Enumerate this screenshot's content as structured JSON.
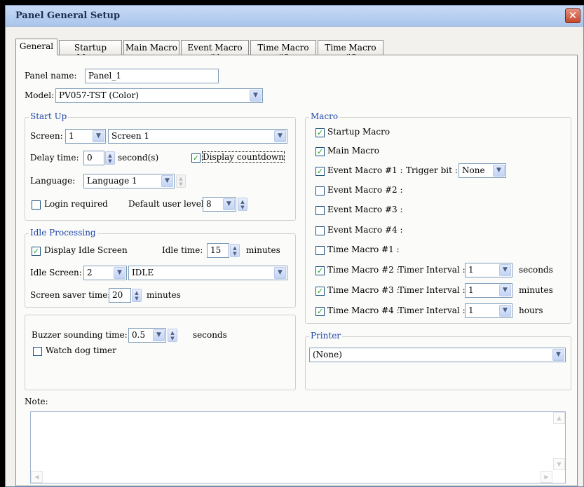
{
  "window": {
    "title": "Panel General Setup",
    "close_glyph": "✕"
  },
  "tabs": [
    {
      "label": "General"
    },
    {
      "label": "Startup Macro"
    },
    {
      "label": "Main Macro"
    },
    {
      "label": "Event Macro #1"
    },
    {
      "label": "Time Macro #2"
    },
    {
      "label": "Time Macro #3"
    }
  ],
  "general": {
    "panel_name_label": "Panel name:",
    "panel_name_value": "Panel_1",
    "model_label": "Model:",
    "model_value": "PV057-TST (Color)"
  },
  "startup": {
    "group_label": "Start Up",
    "screen_label": "Screen:",
    "screen_number": "1",
    "screen_name": "Screen 1",
    "delay_label": "Delay time:",
    "delay_value": "0",
    "delay_unit": "second(s)",
    "display_countdown_label": "Display countdown",
    "display_countdown_checked": true,
    "language_label": "Language:",
    "language_value": "Language 1",
    "login_label": "Login required",
    "login_checked": false,
    "default_level_label": "Default user level:",
    "default_level_value": "8"
  },
  "idle": {
    "group_label": "Idle Processing",
    "display_idle_label": "Display Idle Screen",
    "display_idle_checked": true,
    "idle_time_label": "Idle time:",
    "idle_time_value": "15",
    "idle_time_unit": "minutes",
    "idle_screen_label": "Idle Screen:",
    "idle_screen_number": "2",
    "idle_screen_name": "IDLE",
    "saver_label": "Screen saver time:",
    "saver_value": "20",
    "saver_unit": "minutes"
  },
  "misc": {
    "buzzer_label": "Buzzer sounding time:",
    "buzzer_value": "0.5",
    "buzzer_unit": "seconds",
    "watchdog_label": "Watch dog timer",
    "watchdog_checked": false
  },
  "macro": {
    "group_label": "Macro",
    "startup_macro": {
      "label": "Startup Macro",
      "checked": true
    },
    "main_macro": {
      "label": "Main Macro",
      "checked": true
    },
    "event_macros": [
      {
        "label": "Event Macro #1 :",
        "checked": true,
        "trigger_label": "Trigger bit :",
        "trigger_value": "None"
      },
      {
        "label": "Event Macro #2 :",
        "checked": false
      },
      {
        "label": "Event Macro #3 :",
        "checked": false
      },
      {
        "label": "Event Macro #4 :",
        "checked": false
      }
    ],
    "time_macros": [
      {
        "label": "Time Macro #1 :",
        "checked": false
      },
      {
        "label": "Time Macro #2 :",
        "checked": true,
        "interval_label": "Timer Interval :",
        "interval_value": "1",
        "unit": "seconds"
      },
      {
        "label": "Time Macro #3 :",
        "checked": true,
        "interval_label": "Timer Interval :",
        "interval_value": "1",
        "unit": "minutes"
      },
      {
        "label": "Time Macro #4 :",
        "checked": true,
        "interval_label": "Timer Interval :",
        "interval_value": "1",
        "unit": "hours"
      }
    ]
  },
  "printer": {
    "group_label": "Printer",
    "value": "(None)"
  },
  "note": {
    "label": "Note:",
    "value": ""
  },
  "glyphs": {
    "dropdown": "▼",
    "spin_up": "▲",
    "spin_down": "▼",
    "check": "✓",
    "scroll_up": "▲",
    "scroll_down": "▼",
    "scroll_left": "◀",
    "scroll_right": "▶"
  }
}
